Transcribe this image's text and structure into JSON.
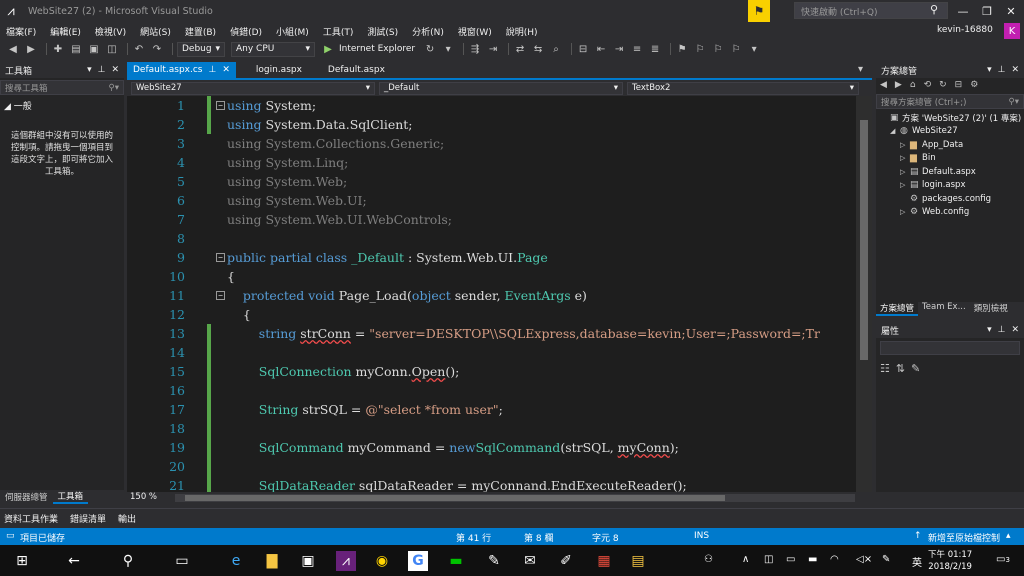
{
  "window": {
    "title": "WebSite27 (2) - Microsoft Visual Studio",
    "logo": "vs-logo-icon"
  },
  "quick_launch": {
    "placeholder": "快速啟動 (Ctrl+Q)"
  },
  "menu": [
    "檔案(F)",
    "編輯(E)",
    "檢視(V)",
    "網站(S)",
    "建置(B)",
    "偵錯(D)",
    "小組(M)",
    "工具(T)",
    "測試(S)",
    "分析(N)",
    "視窗(W)",
    "說明(H)"
  ],
  "account": {
    "user": "kevin-16880",
    "avatar": "K"
  },
  "toolbar": {
    "config": "Debug",
    "platform": "Any CPU",
    "run_label": "Internet Explorer"
  },
  "toolbox": {
    "title": "工具箱",
    "search_placeholder": "搜尋工具箱",
    "group": "◢ 一般",
    "message": "這個群組中沒有可以使用的控制項。請拖曳一個項目到這段文字上，即可將它加入工具箱。",
    "bottom_tabs": [
      "伺服器總管",
      "工具箱"
    ]
  },
  "editor": {
    "tabs": [
      {
        "label": "Default.aspx.cs",
        "active": true
      },
      {
        "label": "login.aspx",
        "active": false
      },
      {
        "label": "Default.aspx",
        "active": false
      }
    ],
    "nav": {
      "project": "WebSite27",
      "class": "_Default",
      "member": "TextBox2"
    },
    "zoom": "150 %"
  },
  "code_lines": [
    {
      "n": "1",
      "parts": [
        [
          "kw",
          "using"
        ],
        [
          "",
          "System;"
        ]
      ]
    },
    {
      "n": "2",
      "parts": [
        [
          "kw",
          "using"
        ],
        [
          "",
          "System.Data.SqlClient;"
        ]
      ]
    },
    {
      "n": "3",
      "parts": [
        [
          "dim",
          "using System.Collections.Generic;"
        ]
      ]
    },
    {
      "n": "4",
      "parts": [
        [
          "dim",
          "using System.Linq;"
        ]
      ]
    },
    {
      "n": "5",
      "parts": [
        [
          "dim",
          "using System.Web;"
        ]
      ]
    },
    {
      "n": "6",
      "parts": [
        [
          "dim",
          "using System.Web.UI;"
        ]
      ]
    },
    {
      "n": "7",
      "parts": [
        [
          "dim",
          "using System.Web.UI.WebControls;"
        ]
      ]
    },
    {
      "n": "8",
      "parts": []
    },
    {
      "n": "9",
      "parts": [
        [
          "kw",
          "public partial class"
        ],
        [
          "ty",
          "_Default"
        ],
        [
          "",
          " : System.Web.UI."
        ],
        [
          "ty",
          "Page"
        ]
      ]
    },
    {
      "n": "10",
      "parts": [
        [
          "",
          "{"
        ]
      ]
    },
    {
      "n": "11",
      "parts": [
        [
          "",
          "    "
        ],
        [
          "kw",
          "protected void"
        ],
        [
          "",
          " Page_Load("
        ],
        [
          "kw",
          "object"
        ],
        [
          "",
          " sender, "
        ],
        [
          "ty",
          "EventArgs"
        ],
        [
          "",
          " e)"
        ]
      ]
    },
    {
      "n": "12",
      "parts": [
        [
          "",
          "    {"
        ]
      ]
    },
    {
      "n": "13",
      "parts": [
        [
          "",
          "        "
        ],
        [
          "kw",
          "string"
        ],
        [
          "",
          " "
        ],
        [
          "sq",
          "strConn"
        ],
        [
          "",
          " = "
        ],
        [
          "str",
          "\"server=DESKTOP\\\\SQLExpress,database=kevin;User=;Password=;Tr"
        ]
      ]
    },
    {
      "n": "14",
      "parts": []
    },
    {
      "n": "15",
      "parts": [
        [
          "",
          "        "
        ],
        [
          "ty",
          "SqlConnection"
        ],
        [
          "",
          " myConn."
        ],
        [
          "sq",
          "Open"
        ],
        [
          "",
          "();"
        ]
      ]
    },
    {
      "n": "16",
      "parts": []
    },
    {
      "n": "17",
      "parts": [
        [
          "",
          "        "
        ],
        [
          "ty",
          "String"
        ],
        [
          "",
          " strSQL = "
        ],
        [
          "str",
          "@\"select *from user\""
        ],
        [
          "",
          ";"
        ]
      ]
    },
    {
      "n": "18",
      "parts": []
    },
    {
      "n": "19",
      "parts": [
        [
          "",
          "        "
        ],
        [
          "ty",
          "SqlCommand"
        ],
        [
          "",
          " myCommand = "
        ],
        [
          "kw",
          "new"
        ],
        [
          " ",
          ""
        ],
        [
          "ty",
          "SqlCommand"
        ],
        [
          "",
          "(strSQL, "
        ],
        [
          "sq",
          "myConn"
        ],
        [
          "",
          ");"
        ]
      ]
    },
    {
      "n": "20",
      "parts": []
    },
    {
      "n": "21",
      "parts": [
        [
          "",
          "        "
        ],
        [
          "ty",
          "SqlDataReader"
        ],
        [
          "",
          " sqlDataReader = myConnand.EndExecuteReader();"
        ]
      ]
    }
  ],
  "solution_explorer": {
    "title": "方案總管",
    "search_placeholder": "搜尋方案總管 (Ctrl+;)",
    "items": [
      {
        "label": "方案 'WebSite27 (2)' (1 專案)",
        "indent": 0,
        "exp": "",
        "icon": "solution-icon"
      },
      {
        "label": "WebSite27",
        "indent": 1,
        "exp": "◢",
        "icon": "globe-icon"
      },
      {
        "label": "App_Data",
        "indent": 2,
        "exp": "▷",
        "icon": "folder-icon"
      },
      {
        "label": "Bin",
        "indent": 2,
        "exp": "▷",
        "icon": "folder-icon"
      },
      {
        "label": "Default.aspx",
        "indent": 2,
        "exp": "▷",
        "icon": "page-icon"
      },
      {
        "label": "login.aspx",
        "indent": 2,
        "exp": "▷",
        "icon": "page-icon"
      },
      {
        "label": "packages.config",
        "indent": 2,
        "exp": "",
        "icon": "config-icon"
      },
      {
        "label": "Web.config",
        "indent": 2,
        "exp": "▷",
        "icon": "config-icon"
      }
    ],
    "tabs": [
      "方案總管",
      "Team Ex...",
      "類別檢視"
    ]
  },
  "properties": {
    "title": "屬性"
  },
  "output_tabs": [
    "資料工具作業",
    "錯誤清單",
    "輸出"
  ],
  "status": {
    "left": "項目已儲存",
    "line": "第 41 行",
    "col": "第 8 欄",
    "ch": "字元 8",
    "mode": "INS",
    "source_control": "新增至原始檔控制"
  },
  "taskbar": {
    "time": "下午 01:17",
    "date": "2018/2/19",
    "ime": "英",
    "notif": "3"
  }
}
